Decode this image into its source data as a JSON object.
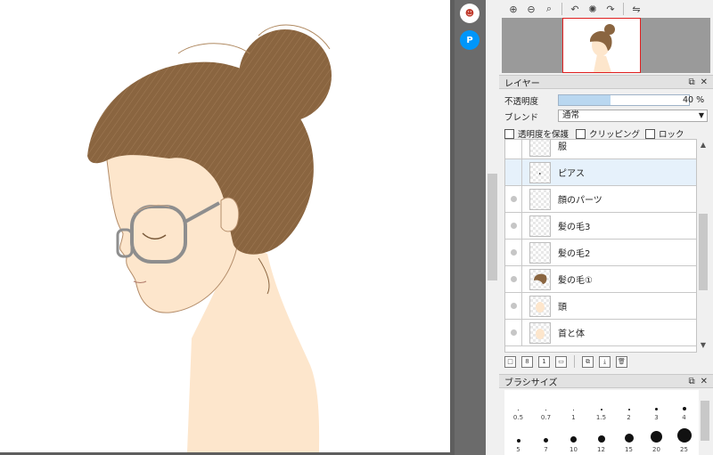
{
  "toolbar": {
    "items": [
      {
        "name": "zoom-in-icon",
        "glyph": "⊕"
      },
      {
        "name": "zoom-out-icon",
        "glyph": "⊖"
      },
      {
        "name": "zoom-reset-icon",
        "glyph": "⌕"
      },
      {
        "name": "rotate-left-icon",
        "glyph": "↶"
      },
      {
        "name": "rotate-reset-icon",
        "glyph": "✺"
      },
      {
        "name": "rotate-right-icon",
        "glyph": "↷"
      },
      {
        "name": "flip-icon",
        "glyph": "⇋"
      }
    ]
  },
  "side_apps": [
    {
      "name": "medibang-mascot-icon",
      "glyph": "☻",
      "bg": "#ffffff",
      "color": "#c0392b"
    },
    {
      "name": "pixiv-icon",
      "glyph": "P",
      "bg": "#0096fa",
      "color": "#ffffff"
    }
  ],
  "layer_panel": {
    "title": "レイヤー",
    "opacity_label": "不透明度",
    "opacity_value": "40 %",
    "opacity_fraction": 0.4,
    "blend_label": "ブレンド",
    "blend_value": "通常",
    "protect_alpha_label": "透明度を保護",
    "clipping_label": "クリッピング",
    "lock_label": "ロック",
    "layers": [
      {
        "name": "服",
        "selected": false,
        "visible": false,
        "thumb": "empty"
      },
      {
        "name": "ピアス",
        "selected": true,
        "visible": false,
        "thumb": "dot"
      },
      {
        "name": "顔のパーツ",
        "selected": false,
        "visible": true,
        "thumb": "empty"
      },
      {
        "name": "髪の毛3",
        "selected": false,
        "visible": true,
        "thumb": "empty"
      },
      {
        "name": "髪の毛2",
        "selected": false,
        "visible": true,
        "thumb": "empty"
      },
      {
        "name": "髪の毛①",
        "selected": false,
        "visible": true,
        "thumb": "hair"
      },
      {
        "name": "頭",
        "selected": false,
        "visible": true,
        "thumb": "skin"
      },
      {
        "name": "首と体",
        "selected": false,
        "visible": true,
        "thumb": "skin"
      }
    ],
    "tools": [
      {
        "name": "new-layer-icon",
        "glyph": "□"
      },
      {
        "name": "new-8bit-layer-icon",
        "glyph": "8"
      },
      {
        "name": "new-1bit-layer-icon",
        "glyph": "1"
      },
      {
        "name": "new-folder-icon",
        "glyph": "▭"
      },
      {
        "name": "duplicate-layer-icon",
        "glyph": "⧉"
      },
      {
        "name": "merge-down-icon",
        "glyph": "⤓"
      },
      {
        "name": "delete-layer-icon",
        "glyph": "🗑"
      }
    ]
  },
  "brush_panel": {
    "title": "ブラシサイズ",
    "sizes": [
      {
        "label": "0.5",
        "d": 1
      },
      {
        "label": "0.7",
        "d": 1
      },
      {
        "label": "1",
        "d": 1
      },
      {
        "label": "1.5",
        "d": 2
      },
      {
        "label": "2",
        "d": 2
      },
      {
        "label": "3",
        "d": 3
      },
      {
        "label": "4",
        "d": 4
      },
      {
        "label": "5",
        "d": 4
      },
      {
        "label": "7",
        "d": 5
      },
      {
        "label": "10",
        "d": 7
      },
      {
        "label": "12",
        "d": 8
      },
      {
        "label": "15",
        "d": 10
      },
      {
        "label": "20",
        "d": 13
      },
      {
        "label": "25",
        "d": 16
      }
    ]
  },
  "colors": {
    "hair": "#8a6540",
    "skin": "#fde6cc",
    "glasses": "#8e8e8e",
    "nav_frame": "#e02020"
  }
}
